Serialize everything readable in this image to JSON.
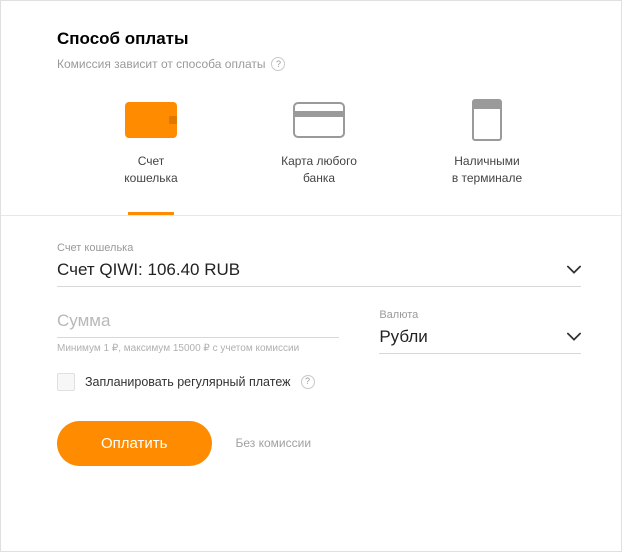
{
  "header": {
    "title": "Способ оплаты",
    "subtitle": "Комиссия зависит от способа оплаты"
  },
  "methods": [
    {
      "id": "wallet",
      "label": "Счет\nкошелька",
      "active": true
    },
    {
      "id": "card",
      "label": "Карта любого\nбанка",
      "active": false
    },
    {
      "id": "terminal",
      "label": "Наличными\nв терминале",
      "active": false
    }
  ],
  "account": {
    "label": "Счет кошелька",
    "value": "Счет QIWI: 106.40 RUB"
  },
  "amount": {
    "placeholder": "Сумма",
    "hint": "Минимум 1 ₽, максимум 15000 ₽ с учетом комиссии"
  },
  "currency": {
    "label": "Валюта",
    "value": "Рубли"
  },
  "schedule": {
    "label": "Запланировать регулярный платеж"
  },
  "action": {
    "pay": "Оплатить",
    "commission": "Без комиссии"
  }
}
